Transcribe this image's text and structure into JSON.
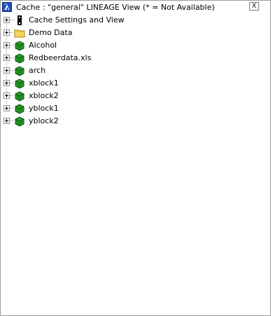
{
  "window": {
    "title": "Cache : \"general\" LINEAGE View (* = Not Available)",
    "close_label": "X",
    "app_icon_glyph": "λ"
  },
  "tree": {
    "items": [
      {
        "label": "Cache Settings and View",
        "icon": "settings-icon"
      },
      {
        "label": "Demo Data",
        "icon": "folder-icon"
      },
      {
        "label": "Alcohol",
        "icon": "data-cube-icon"
      },
      {
        "label": "Redbeerdata.xls",
        "icon": "data-cube-icon"
      },
      {
        "label": "arch",
        "icon": "data-cube-icon"
      },
      {
        "label": "xblock1",
        "icon": "data-cube-icon"
      },
      {
        "label": "xblock2",
        "icon": "data-cube-icon"
      },
      {
        "label": "yblock1",
        "icon": "data-cube-icon"
      },
      {
        "label": "yblock2",
        "icon": "data-cube-icon"
      }
    ]
  },
  "colors": {
    "cube_green": "#2f9e2f",
    "cube_dark": "#0f5a0f",
    "folder_yellow": "#f5d45a",
    "folder_edge": "#b08a1a"
  }
}
